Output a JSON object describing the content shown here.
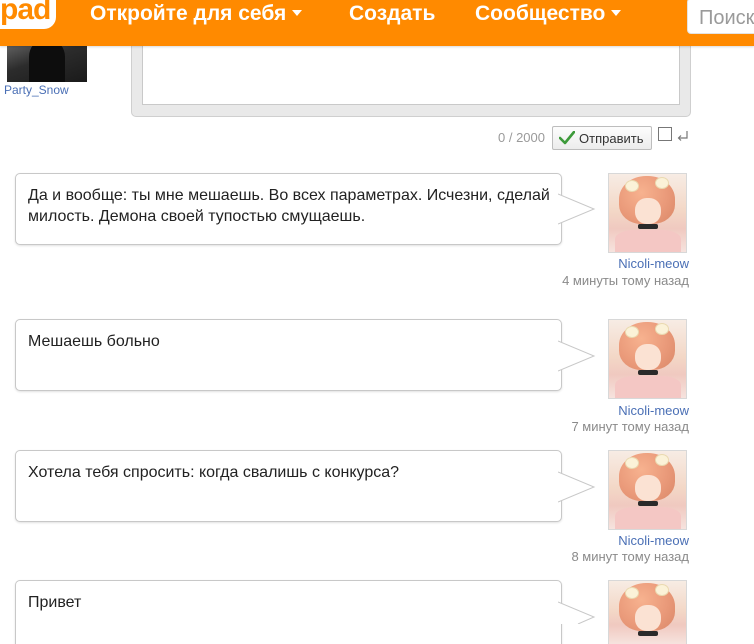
{
  "header": {
    "logo_text": "pad",
    "nav": {
      "discover": "Откройте для себя",
      "create": "Создать",
      "community": "Сообщество"
    },
    "search_placeholder": "Поиск",
    "accent_color": "#ff8a00"
  },
  "composer": {
    "username": "Party_Snow",
    "counter": "0 / 2000",
    "send_label": "Отправить",
    "enter_to_send_checked": false
  },
  "messages": [
    {
      "text": "Да и вообще: ты мне мешаешь. Во всех параметрах. Исчезни, сделай милость. Демона своей тупостью смущаешь.",
      "author": "Nicoli-meow",
      "time": "4 минуты тому назад"
    },
    {
      "text": "Мешаешь больно",
      "author": "Nicoli-meow",
      "time": "7 минут тому назад"
    },
    {
      "text": "Хотела тебя спросить: когда свалишь с конкурса?",
      "author": "Nicoli-meow",
      "time": "8 минут тому назад"
    },
    {
      "text": "Привет",
      "author": "",
      "time": ""
    }
  ]
}
